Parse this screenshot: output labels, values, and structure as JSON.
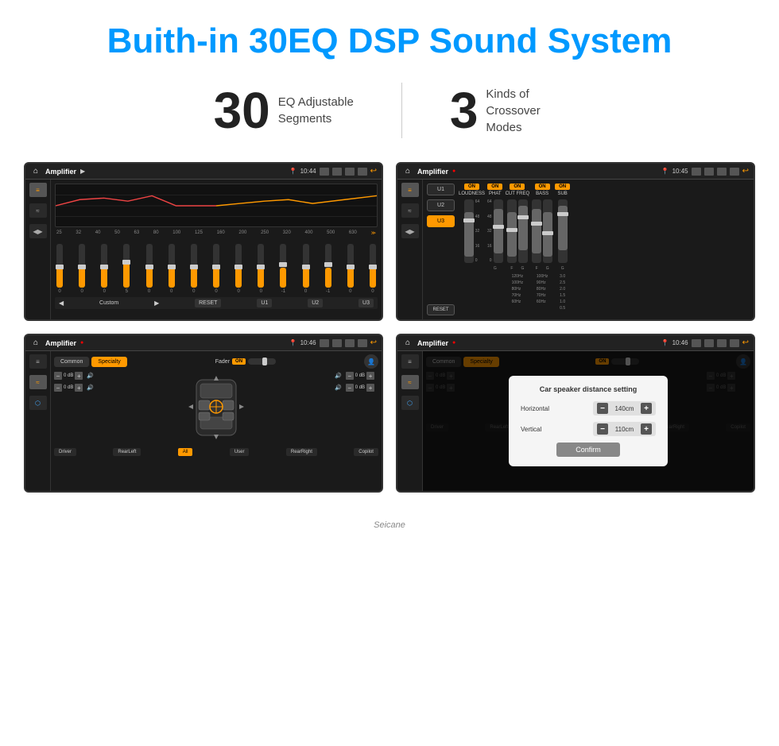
{
  "header": {
    "title": "Buith-in 30EQ DSP Sound System"
  },
  "stats": [
    {
      "number": "30",
      "label": "EQ Adjustable\nSegments"
    },
    {
      "number": "3",
      "label": "Kinds of\nCrossover Modes"
    }
  ],
  "screens": [
    {
      "id": "eq-screen",
      "topbar": {
        "title": "Amplifier",
        "time": "10:44"
      },
      "eq_labels": [
        "25",
        "32",
        "40",
        "50",
        "63",
        "80",
        "100",
        "125",
        "160",
        "200",
        "250",
        "320",
        "400",
        "500",
        "630"
      ],
      "eq_values": [
        0,
        0,
        0,
        5,
        0,
        0,
        0,
        0,
        0,
        0,
        -1,
        0,
        -1,
        0,
        0
      ],
      "bottom_buttons": [
        "Custom",
        "RESET",
        "U1",
        "U2",
        "U3"
      ]
    },
    {
      "id": "crossover-screen",
      "topbar": {
        "title": "Amplifier",
        "time": "10:45"
      },
      "presets": [
        "U1",
        "U2",
        "U3"
      ],
      "active_preset": "U3",
      "channels": [
        {
          "name": "LOUDNESS",
          "on": true
        },
        {
          "name": "PHAT",
          "on": true
        },
        {
          "name": "CUT FREQ",
          "on": true
        },
        {
          "name": "BASS",
          "on": true
        },
        {
          "name": "SUB",
          "on": true
        }
      ],
      "reset_label": "RESET"
    },
    {
      "id": "specialty-screen",
      "topbar": {
        "title": "Amplifier",
        "time": "10:46"
      },
      "tabs": [
        "Common",
        "Specialty"
      ],
      "active_tab": "Specialty",
      "fader_label": "Fader",
      "fader_on": "ON",
      "controls": {
        "top_left": "0 dB",
        "top_right": "0 dB",
        "bot_left": "0 dB",
        "bot_right": "0 dB"
      },
      "position_labels": [
        "Driver",
        "RearLeft",
        "All",
        "User",
        "RearRight",
        "Copilot"
      ]
    },
    {
      "id": "distance-screen",
      "topbar": {
        "title": "Amplifier",
        "time": "10:46"
      },
      "tabs": [
        "Common",
        "Specialty"
      ],
      "active_tab": "Specialty",
      "modal": {
        "title": "Car speaker distance setting",
        "horizontal_label": "Horizontal",
        "horizontal_value": "140cm",
        "vertical_label": "Vertical",
        "vertical_value": "110cm",
        "confirm_label": "Confirm"
      },
      "controls": {
        "top_right": "0 dB",
        "bot_right": "0 dB"
      },
      "position_labels": [
        "Driver",
        "RearLeft",
        "All",
        "User",
        "RearRight",
        "Copilot"
      ]
    }
  ],
  "watermark": "Seicane"
}
